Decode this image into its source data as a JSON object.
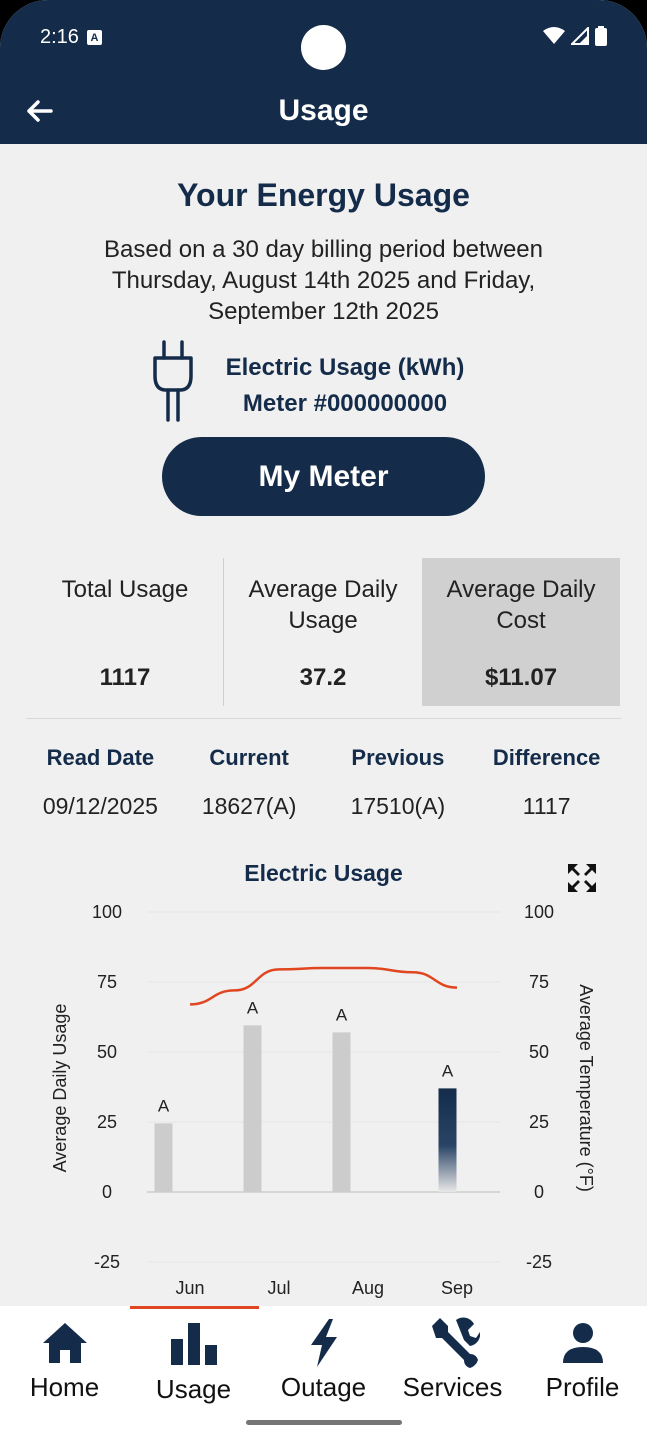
{
  "status": {
    "time": "2:16",
    "notif_badge": "A"
  },
  "header": {
    "title": "Usage"
  },
  "main": {
    "heading": "Your Energy Usage",
    "period_text": "Based on a 30 day billing period between Thursday, August 14th 2025 and Friday, September 12th 2025",
    "usage_type": "Electric Usage (kWh)",
    "meter_number": "Meter #000000000",
    "meter_button": "My Meter"
  },
  "stats": [
    {
      "label": "Total Usage",
      "value": "1117",
      "selected": false
    },
    {
      "label": "Average Daily Usage",
      "value": "37.2",
      "selected": false
    },
    {
      "label": "Average Daily Cost",
      "value": "$11.07",
      "selected": true
    }
  ],
  "readings": {
    "headers": [
      "Read Date",
      "Current",
      "Previous",
      "Difference"
    ],
    "row": [
      "09/12/2025",
      "18627(A)",
      "17510(A)",
      "1117"
    ]
  },
  "chart_data": {
    "type": "bar",
    "title": "Electric Usage",
    "categories": [
      "Jun",
      "Jul",
      "Aug",
      "Sep"
    ],
    "series": [
      {
        "name": "Average Daily Usage",
        "type": "bar",
        "values": [
          24.5,
          59.5,
          57,
          37
        ],
        "labels": [
          "A",
          "A",
          "A",
          "A"
        ]
      },
      {
        "name": "Average Temperature (°F)",
        "type": "line",
        "x": [
          0.0,
          0.5,
          1.0,
          1.5,
          2.0,
          2.5,
          3.0
        ],
        "values": [
          67,
          72,
          79.5,
          80,
          80,
          78.5,
          73
        ]
      }
    ],
    "ylabel": "Average Daily Usage",
    "y2label": "Average Temperature (°F)",
    "ylim": [
      -25,
      100
    ],
    "y2lim": [
      -25,
      100
    ],
    "yticks": [
      100,
      75,
      50,
      25,
      0,
      -25
    ],
    "colors": {
      "bar": "#cccccc",
      "bar_current": "#142c4a",
      "line": "#e0461f"
    }
  },
  "nav": [
    {
      "label": "Home",
      "icon": "home-icon",
      "active": false
    },
    {
      "label": "Usage",
      "icon": "bar-chart-icon",
      "active": true
    },
    {
      "label": "Outage",
      "icon": "lightning-icon",
      "active": false
    },
    {
      "label": "Services",
      "icon": "wrench-icon",
      "active": false
    },
    {
      "label": "Profile",
      "icon": "person-icon",
      "active": false
    }
  ],
  "colors": {
    "brand": "#142c4a",
    "accent": "#e0461f",
    "background": "#f0f0f0"
  }
}
